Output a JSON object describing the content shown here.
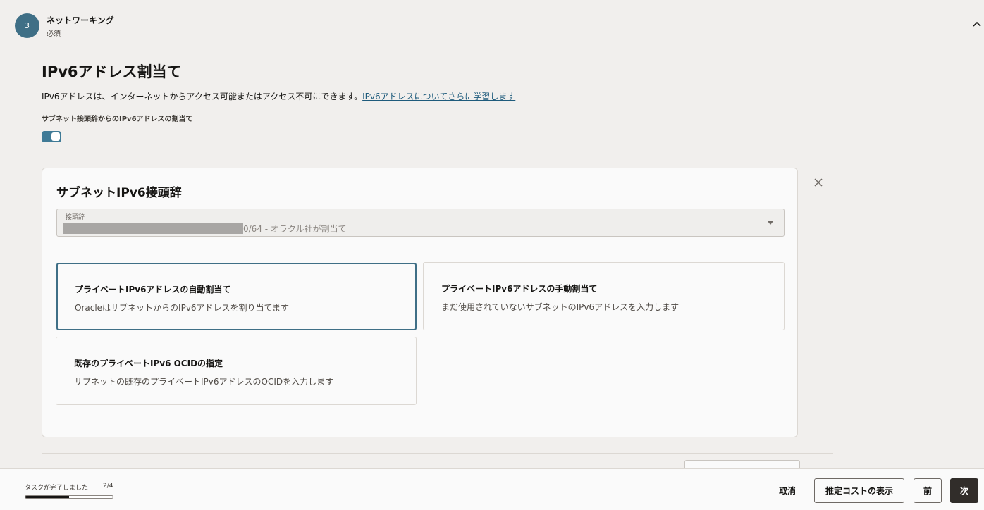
{
  "step": {
    "number": "3",
    "title": "ネットワーキング",
    "subtitle": "必須"
  },
  "section": {
    "title": "IPv6アドレス割当て",
    "description": "IPv6アドレスは、インターネットからアクセス可能またはアクセス不可にできます。",
    "link": "IPv6アドレスについてさらに学習します",
    "toggle_label": "サブネット接頭辞からのIPv6アドレスの割当て",
    "toggle_on": true
  },
  "card": {
    "title": "サブネットIPv6接頭辞",
    "select_label": "接頭辞",
    "select_value": "0/64 - オラクル社が割当て",
    "options": [
      {
        "title": "プライベートIPv6アドレスの自動割当て",
        "description": "OracleはサブネットからのIPv6アドレスを割り当てます"
      },
      {
        "title": "プライベートIPv6アドレスの手動割当て",
        "description": "まだ使用されていないサブネットのIPv6アドレスを入力します"
      },
      {
        "title": "既存のプライベートIPv6 OCIDの指定",
        "description": "サブネットの既存のプライベートIPv6アドレスのOCIDを入力します"
      }
    ]
  },
  "footer": {
    "task_label": "タスクが完了しました",
    "task_count": "2/4",
    "progress_fraction": 0.5,
    "cancel": "取消",
    "estimate_cost": "推定コストの表示",
    "previous": "前",
    "next": "次"
  },
  "colors": {
    "accent": "#3f6f86",
    "link": "#1e5b7c",
    "primary_button": "#312d2a"
  },
  "icons": [
    "chevron-up-icon",
    "close-icon",
    "caret-down-icon"
  ]
}
